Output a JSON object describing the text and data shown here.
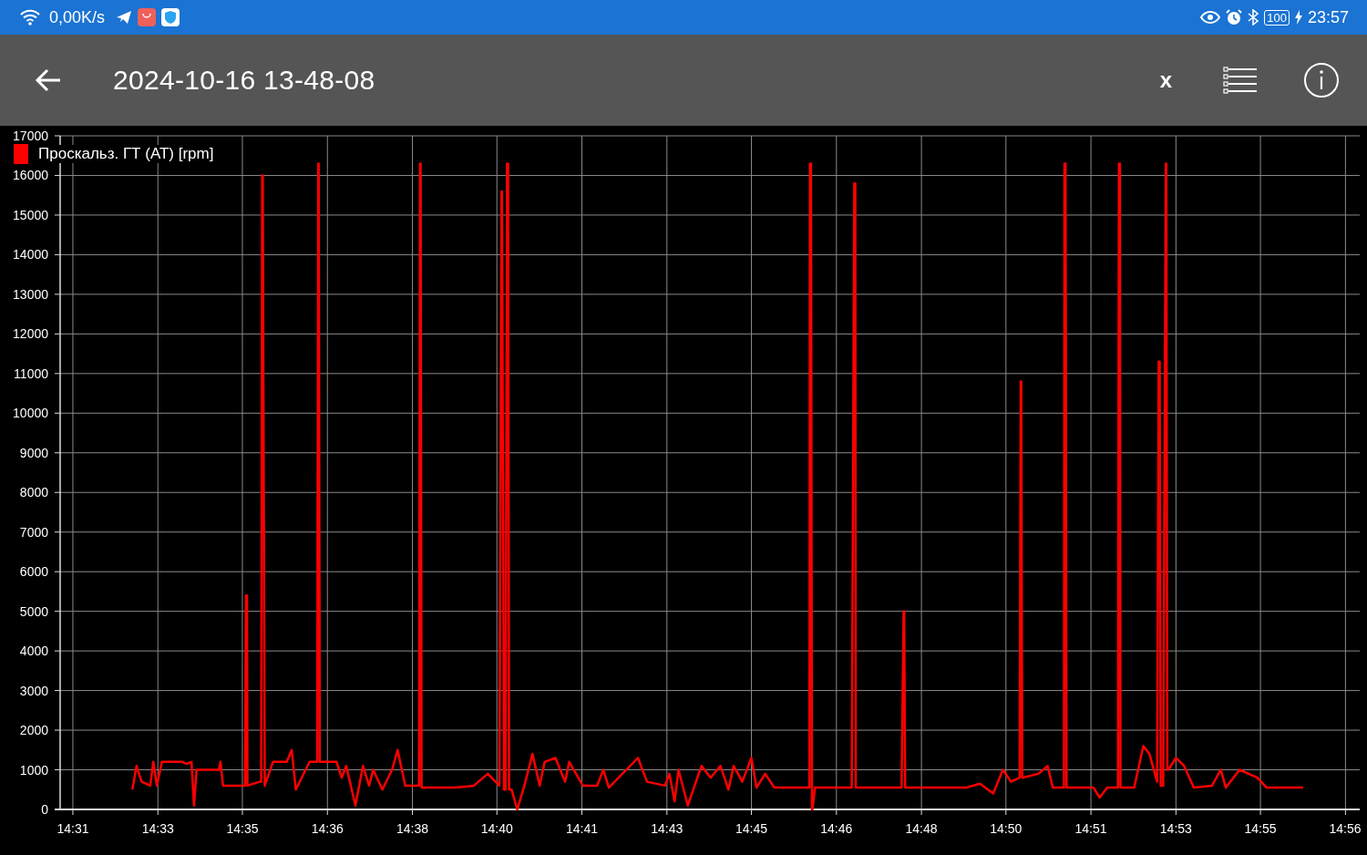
{
  "status_bar": {
    "network_speed": "0,00K/s",
    "battery": "100",
    "time": "23:57"
  },
  "toolbar": {
    "title": "2024-10-16 13-48-08",
    "x_button": "x"
  },
  "chart": {
    "chart_data": {
      "type": "line",
      "grid": true,
      "x": [
        872.47,
        872.55,
        872.65,
        872.82,
        872.88,
        872.95,
        873.05,
        873.45,
        873.53,
        873.63,
        873.68,
        873.73,
        874.17,
        874.2,
        874.25,
        874.62,
        874.68,
        874.7,
        874.72,
        874.73,
        874.97,
        875.0,
        875.02,
        875.03,
        875.07,
        875.23,
        875.5,
        875.6,
        875.68,
        875.95,
        876.1,
        876.12,
        876.13,
        876.15,
        876.17,
        876.48,
        876.58,
        876.67,
        876.85,
        877.0,
        877.12,
        877.2,
        877.38,
        877.57,
        877.68,
        877.83,
        878.1,
        878.12,
        878.13,
        878.15,
        878.2,
        878.82,
        879.18,
        879.45,
        879.68,
        879.72,
        879.73,
        879.77,
        879.8,
        879.83,
        879.85,
        879.87,
        879.92,
        880.03,
        880.17,
        880.33,
        880.47,
        880.57,
        880.78,
        880.97,
        881.05,
        881.32,
        881.6,
        881.72,
        881.83,
        882.4,
        882.58,
        882.93,
        883.02,
        883.12,
        883.2,
        883.38,
        883.65,
        883.83,
        884.02,
        884.18,
        884.28,
        884.45,
        884.63,
        884.73,
        884.9,
        885.08,
        885.77,
        885.78,
        885.8,
        885.82,
        885.83,
        885.88,
        886.6,
        886.65,
        886.67,
        886.68,
        886.72,
        887.58,
        887.62,
        887.63,
        887.65,
        887.67,
        888.85,
        889.12,
        889.38,
        889.57,
        889.73,
        889.9,
        889.92,
        889.93,
        889.95,
        890.27,
        890.45,
        890.55,
        890.77,
        890.78,
        890.8,
        890.82,
        891.35,
        891.47,
        891.62,
        891.83,
        891.85,
        891.87,
        891.88,
        892.15,
        892.33,
        892.45,
        892.6,
        892.63,
        892.65,
        892.67,
        892.72,
        892.77,
        892.78,
        892.8,
        892.82,
        892.97,
        893.13,
        893.32,
        893.68,
        893.85,
        893.95,
        894.22,
        894.57,
        894.75,
        895.47
      ],
      "series": [
        {
          "name": "Проскальз. ГТ (AT) [rpm]",
          "color": "#ff0000",
          "values": [
            500,
            1100,
            700,
            600,
            1200,
            600,
            1200,
            1200,
            1150,
            1200,
            100,
            1000,
            1000,
            1200,
            600,
            600,
            600,
            5400,
            5400,
            600,
            700,
            700,
            16000,
            16000,
            600,
            1200,
            1200,
            1500,
            500,
            1200,
            1200,
            16300,
            16300,
            1200,
            1200,
            1200,
            800,
            1100,
            100,
            1100,
            600,
            1000,
            500,
            1000,
            1500,
            600,
            600,
            16300,
            16300,
            550,
            550,
            550,
            600,
            900,
            600,
            15600,
            15600,
            500,
            500,
            16300,
            16300,
            500,
            500,
            0,
            600,
            1400,
            600,
            1200,
            1300,
            700,
            1200,
            600,
            600,
            1000,
            550,
            1300,
            700,
            600,
            900,
            200,
            1000,
            100,
            1100,
            800,
            1100,
            500,
            1100,
            700,
            1300,
            550,
            900,
            550,
            550,
            16300,
            16300,
            0,
            0,
            550,
            550,
            15800,
            15800,
            550,
            550,
            550,
            5000,
            5000,
            550,
            550,
            550,
            650,
            400,
            1000,
            700,
            800,
            10800,
            10800,
            800,
            900,
            1100,
            550,
            550,
            16300,
            16300,
            550,
            550,
            300,
            550,
            550,
            16300,
            16300,
            550,
            550,
            1600,
            1400,
            700,
            11300,
            11300,
            600,
            600,
            16300,
            16300,
            1000,
            1000,
            1300,
            1100,
            550,
            600,
            1000,
            550,
            1000,
            800,
            550,
            550
          ]
        }
      ],
      "xlim": [
        871.05,
        896.58
      ],
      "ylim": [
        0,
        17000
      ],
      "xticks": [
        {
          "value": 871.3,
          "label": "14:31"
        },
        {
          "value": 872.97,
          "label": "14:33"
        },
        {
          "value": 874.63,
          "label": "14:35"
        },
        {
          "value": 876.3,
          "label": "14:36"
        },
        {
          "value": 877.97,
          "label": "14:38"
        },
        {
          "value": 879.63,
          "label": "14:40"
        },
        {
          "value": 881.3,
          "label": "14:41"
        },
        {
          "value": 882.97,
          "label": "14:43"
        },
        {
          "value": 884.63,
          "label": "14:45"
        },
        {
          "value": 886.3,
          "label": "14:46"
        },
        {
          "value": 887.97,
          "label": "14:48"
        },
        {
          "value": 889.63,
          "label": "14:50"
        },
        {
          "value": 891.3,
          "label": "14:51"
        },
        {
          "value": 892.97,
          "label": "14:53"
        },
        {
          "value": 894.63,
          "label": "14:55"
        },
        {
          "value": 896.3,
          "label": "14:56"
        }
      ],
      "yticks": [
        0,
        1000,
        2000,
        3000,
        4000,
        5000,
        6000,
        7000,
        8000,
        9000,
        10000,
        11000,
        12000,
        13000,
        14000,
        15000,
        16000,
        17000
      ]
    }
  }
}
